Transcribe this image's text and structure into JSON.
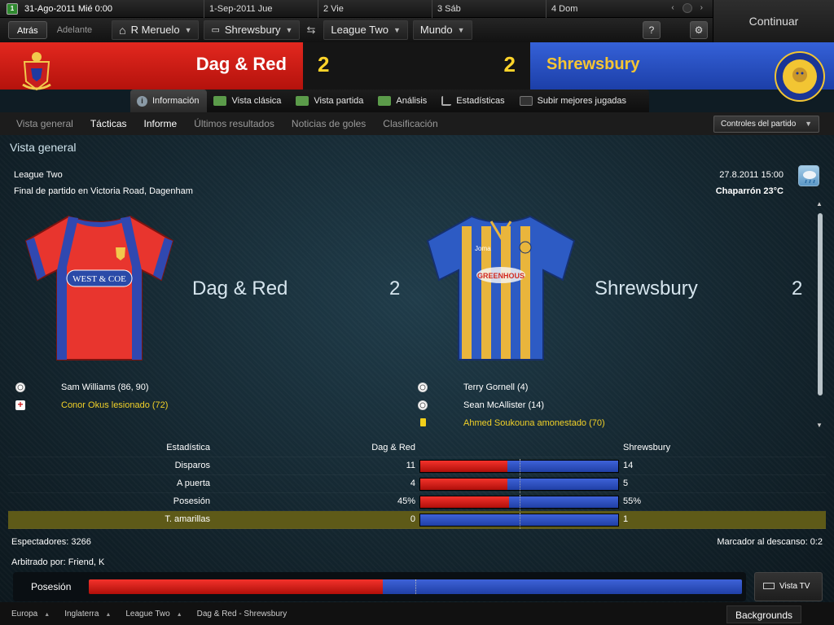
{
  "datebar": {
    "current_date": "31-Ago-2011 Mié  0:00",
    "calendar_icon_text": "1",
    "days": [
      "1-Sep-2011 Jue",
      "2 Vie",
      "3 Sáb",
      "4 Dom"
    ]
  },
  "continue_label": "Continuar",
  "nav": {
    "back": "Atrás",
    "forward": "Adelante",
    "manager": "R Meruelo",
    "club": "Shrewsbury",
    "competition": "League Two",
    "world": "Mundo",
    "help": "?",
    "settings_icon": "gear-icon"
  },
  "header": {
    "home_team": "Dag & Red",
    "home_score": "2",
    "away_score": "2",
    "away_team": "Shrewsbury",
    "home_color": "#e3281f",
    "away_color": "#2a50c6"
  },
  "tabs": [
    {
      "label": "Información",
      "icon": "info-icon"
    },
    {
      "label": "Vista clásica",
      "icon": "pitch-icon"
    },
    {
      "label": "Vista partida",
      "icon": "split-icon"
    },
    {
      "label": "Análisis",
      "icon": "analysis-icon"
    },
    {
      "label": "Estadísticas",
      "icon": "stats-icon"
    },
    {
      "label": "Subir mejores jugadas",
      "icon": "camera-icon"
    }
  ],
  "subnav": {
    "items": [
      "Vista general",
      "Tácticas",
      "Informe",
      "Últimos resultados",
      "Noticias de goles",
      "Clasificación"
    ],
    "match_controls": "Controles del partido"
  },
  "overview": {
    "title": "Vista general",
    "competition": "League Two",
    "venue": "Final de partido en Victoria Road, Dagenham",
    "datetime": "27.8.2011 15:00",
    "weather": "Chaparrón 23°C",
    "home_team": "Dag & Red",
    "home_score": "2",
    "away_team": "Shrewsbury",
    "away_score": "2",
    "home_sponsor": "WEST & COE",
    "away_sponsor": "GREENHOUS",
    "away_kit_brand": "Joma",
    "home_events": [
      {
        "icon": "goal",
        "text": "Sam Williams (86, 90)"
      },
      {
        "icon": "injury",
        "text": "Conor Okus lesionado (72)"
      }
    ],
    "away_events": [
      {
        "icon": "goal",
        "text": "Terry Gornell (4)"
      },
      {
        "icon": "goal",
        "text": "Sean McAllister (14)"
      },
      {
        "icon": "yellow-card",
        "text": "Ahmed Soukouna amonestado (70)"
      }
    ]
  },
  "stats": {
    "header": {
      "label": "Estadística",
      "home": "Dag & Red",
      "away": "Shrewsbury"
    },
    "rows": [
      {
        "label": "Disparos",
        "home": "11",
        "away": "14",
        "home_share": 0.44
      },
      {
        "label": "A puerta",
        "home": "4",
        "away": "5",
        "home_share": 0.44
      },
      {
        "label": "Posesión",
        "home": "45%",
        "away": "55%",
        "home_share": 0.45
      },
      {
        "label": "T. amarillas",
        "home": "0",
        "away": "1",
        "home_share": 0.0
      }
    ]
  },
  "attendance": "Espectadores: 3266",
  "halftime": "Marcador al descanso: 0:2",
  "referee": "Arbitrado por: Friend, K",
  "possession": {
    "label": "Posesión",
    "home_share": 0.45
  },
  "vista_tv": "Vista TV",
  "footer": {
    "crumbs": [
      "Europa",
      "Inglaterra",
      "League Two",
      "Dag & Red - Shrewsbury"
    ],
    "backgrounds": "Backgrounds"
  }
}
